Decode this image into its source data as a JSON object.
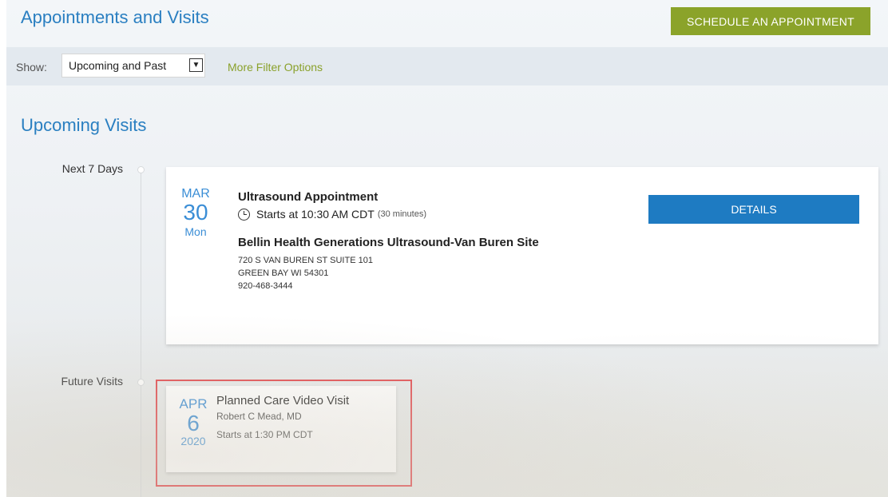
{
  "header": {
    "title": "Appointments and Visits",
    "schedule_button": "SCHEDULE AN APPOINTMENT"
  },
  "filter": {
    "show_label": "Show:",
    "show_value": "Upcoming and Past",
    "more_filters": "More Filter Options"
  },
  "section": {
    "title": "Upcoming Visits"
  },
  "groups": [
    {
      "label": "Next 7 Days",
      "visit": {
        "month": "MAR",
        "day": "30",
        "weekday": "Mon",
        "title": "Ultrasound Appointment",
        "time": "Starts at 10:30 AM CDT",
        "duration": "(30 minutes)",
        "location": "Bellin Health Generations Ultrasound-Van Buren Site",
        "address1": "720 S VAN BUREN ST SUITE 101",
        "address2": "GREEN BAY WI 54301",
        "phone": "920-468-3444",
        "details_button": "DETAILS"
      }
    },
    {
      "label": "Future Visits",
      "visit": {
        "month": "APR",
        "day": "6",
        "year": "2020",
        "title": "Planned Care Video Visit",
        "provider": "Robert C Mead, MD",
        "time": "Starts at 1:30 PM CDT"
      }
    }
  ],
  "colors": {
    "accent_blue": "#2a7fc1",
    "schedule_green": "#8ba32a",
    "details_blue": "#1e7bc2",
    "highlight_red": "#e2474c"
  }
}
